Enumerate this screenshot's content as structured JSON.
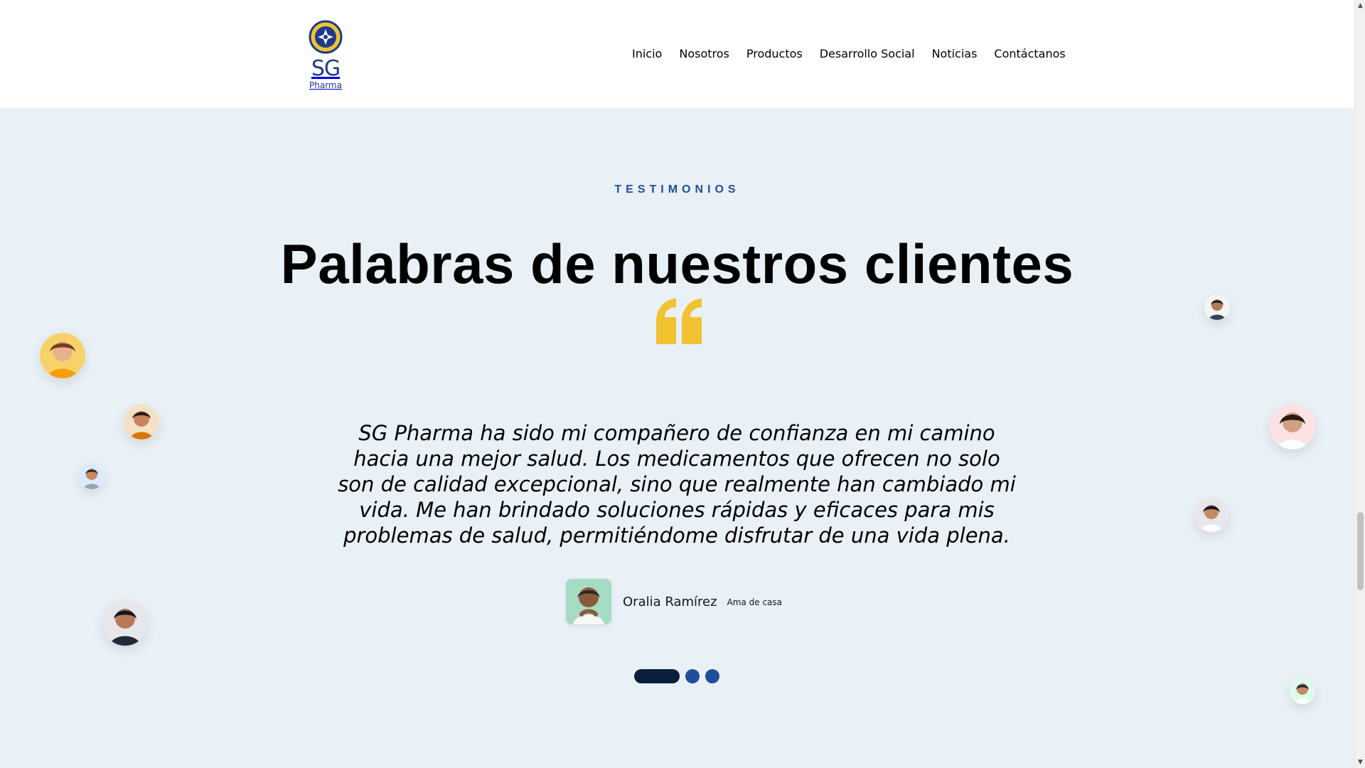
{
  "header": {
    "logo": {
      "text_primary": "SG",
      "text_secondary": "Pharma",
      "icon": "sg-pharma-logo-icon"
    },
    "nav": [
      {
        "label": "Inicio"
      },
      {
        "label": "Nosotros"
      },
      {
        "label": "Productos"
      },
      {
        "label": "Desarrollo Social"
      },
      {
        "label": "Noticias"
      },
      {
        "label": "Contáctanos"
      }
    ]
  },
  "testimonials": {
    "eyebrow": "TESTIMONIOS",
    "title": "Palabras de nuestros clientes",
    "quote_icon": "quote-icon",
    "quote": "SG Pharma ha sido mi compañero de confianza en mi camino hacia una mejor salud. Los medicamentos que ofrecen no solo son de calidad excepcional, sino que realmente han cambiado mi vida. Me han brindado soluciones rápidas y eficaces para mis problemas de salud, permitiéndome disfrutar de una vida plena.",
    "author": {
      "name": "Oralia Ramírez",
      "role": "Ama de casa",
      "avatar_icon": "author-photo"
    },
    "carousel": {
      "active_index": 0,
      "total": 3
    }
  },
  "colors": {
    "section_bg": "#e9f0f6",
    "accent_blue": "#1f4e9b",
    "accent_dark": "#0b1f3d",
    "quote_yellow": "#f1c232",
    "logo_blue": "#1e3a8a"
  }
}
